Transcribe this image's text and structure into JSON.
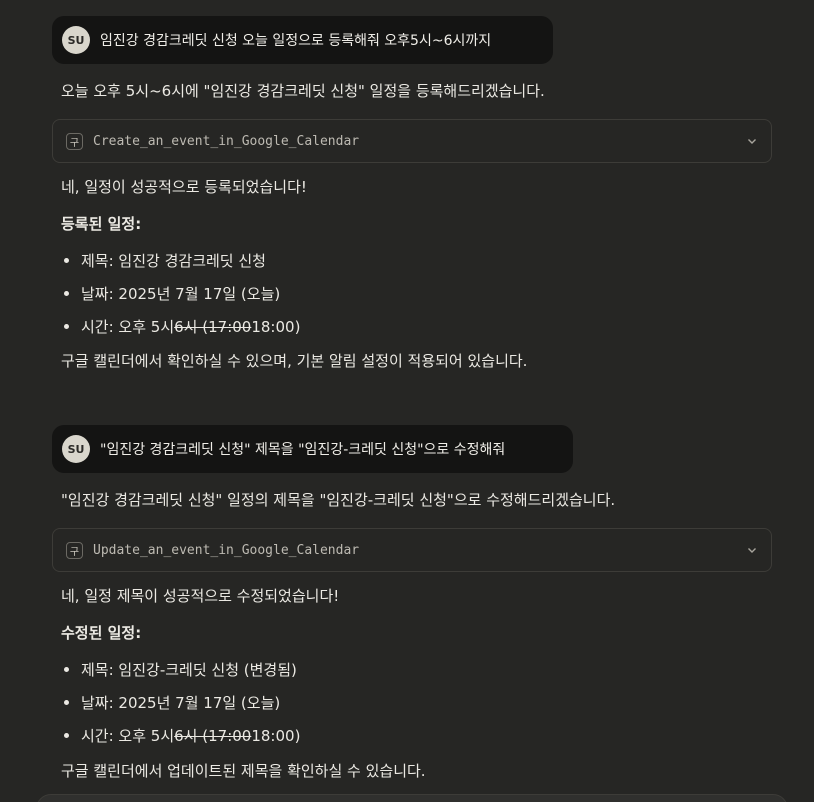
{
  "conversation": {
    "turn1": {
      "user": {
        "avatar": "SU",
        "text": "임진강 경감크레딧 신청 오늘 일정으로 등록해줘 오후5시~6시까지"
      },
      "intro": "오늘 오후 5시~6시에 \"임진강 경감크레딧 신청\" 일정을 등록해드리겠습니다.",
      "tool": {
        "icon": "구",
        "name": "Create_an_event_in_Google_Calendar"
      },
      "result": "네, 일정이 성공적으로 등록되었습니다!",
      "heading": "등록된 일정:",
      "details": {
        "title": "제목: 임진강 경감크레딧 신청",
        "date": "날짜: 2025년 7월 17일 (오늘)",
        "time_prefix": "시간: 오후 5시",
        "time_struck": "6시 (17:00",
        "time_suffix": "18:00)"
      },
      "footer": "구글 캘린더에서 확인하실 수 있으며, 기본 알림 설정이 적용되어 있습니다."
    },
    "turn2": {
      "user": {
        "avatar": "SU",
        "text": "\"임진강 경감크레딧 신청\" 제목을 \"임진강-크레딧 신청\"으로 수정해줘"
      },
      "intro": "\"임진강 경감크레딧 신청\" 일정의 제목을 \"임진강-크레딧 신청\"으로 수정해드리겠습니다.",
      "tool": {
        "icon": "구",
        "name": "Update_an_event_in_Google_Calendar"
      },
      "result": "네, 일정 제목이 성공적으로 수정되었습니다!",
      "heading": "수정된 일정:",
      "details": {
        "title": "제목: 임진강-크레딧 신청 (변경됨)",
        "date": "날짜: 2025년 7월 17일 (오늘)",
        "time_prefix": "시간: 오후 5시",
        "time_struck": "6시 (17:00",
        "time_suffix": "18:00)"
      },
      "footer": "구글 캘린더에서 업데이트된 제목을 확인하실 수 있습니다."
    }
  },
  "icons": {
    "expand": "chevron-down-icon"
  }
}
